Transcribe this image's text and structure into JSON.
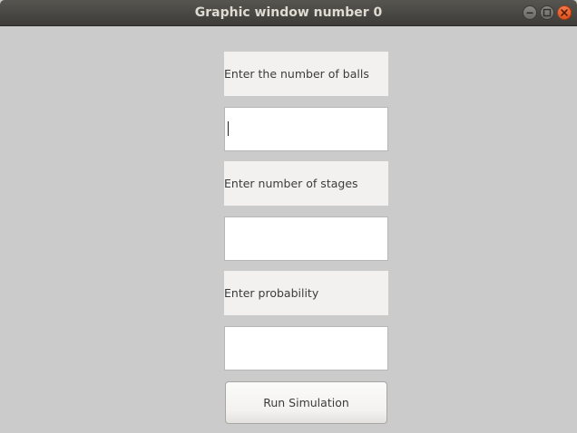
{
  "window": {
    "title": "Graphic window number 0"
  },
  "form": {
    "balls_label": "Enter the number of balls",
    "balls_value": "",
    "stages_label": "Enter number of stages",
    "stages_value": "",
    "probability_label": "Enter probability",
    "probability_value": "",
    "run_button_label": "Run Simulation"
  },
  "icons": {
    "minimize": "minimize-icon",
    "maximize": "maximize-icon",
    "close": "close-icon"
  },
  "colors": {
    "titlebar": "#3d3c38",
    "background": "#cbcbcb",
    "close_button": "#e9582a"
  }
}
